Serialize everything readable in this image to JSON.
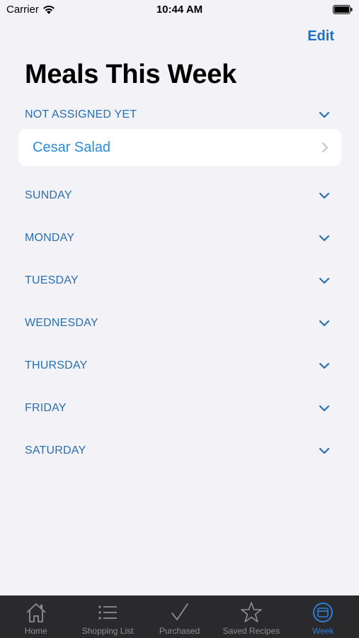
{
  "status": {
    "carrier": "Carrier",
    "time": "10:44 AM"
  },
  "nav": {
    "edit_label": "Edit"
  },
  "page": {
    "title": "Meals This Week"
  },
  "sections": [
    {
      "label": "NOT ASSIGNED YET",
      "expanded": true,
      "items": [
        "Cesar Salad"
      ]
    },
    {
      "label": "SUNDAY"
    },
    {
      "label": "MONDAY"
    },
    {
      "label": "TUESDAY"
    },
    {
      "label": "WEDNESDAY"
    },
    {
      "label": "THURSDAY"
    },
    {
      "label": "FRIDAY"
    },
    {
      "label": "SATURDAY"
    }
  ],
  "tabs": [
    {
      "label": "Home",
      "icon": "house-icon"
    },
    {
      "label": "Shopping List",
      "icon": "list-icon"
    },
    {
      "label": "Purchased",
      "icon": "checkmark-icon"
    },
    {
      "label": "Saved Recipes",
      "icon": "star-icon"
    },
    {
      "label": "Week",
      "icon": "calendar-icon",
      "active": true
    }
  ],
  "colors": {
    "accent": "#1a72c9",
    "section_text": "#2a6fb0",
    "tab_inactive": "#8e8e93",
    "tab_active": "#2b7fd9"
  }
}
